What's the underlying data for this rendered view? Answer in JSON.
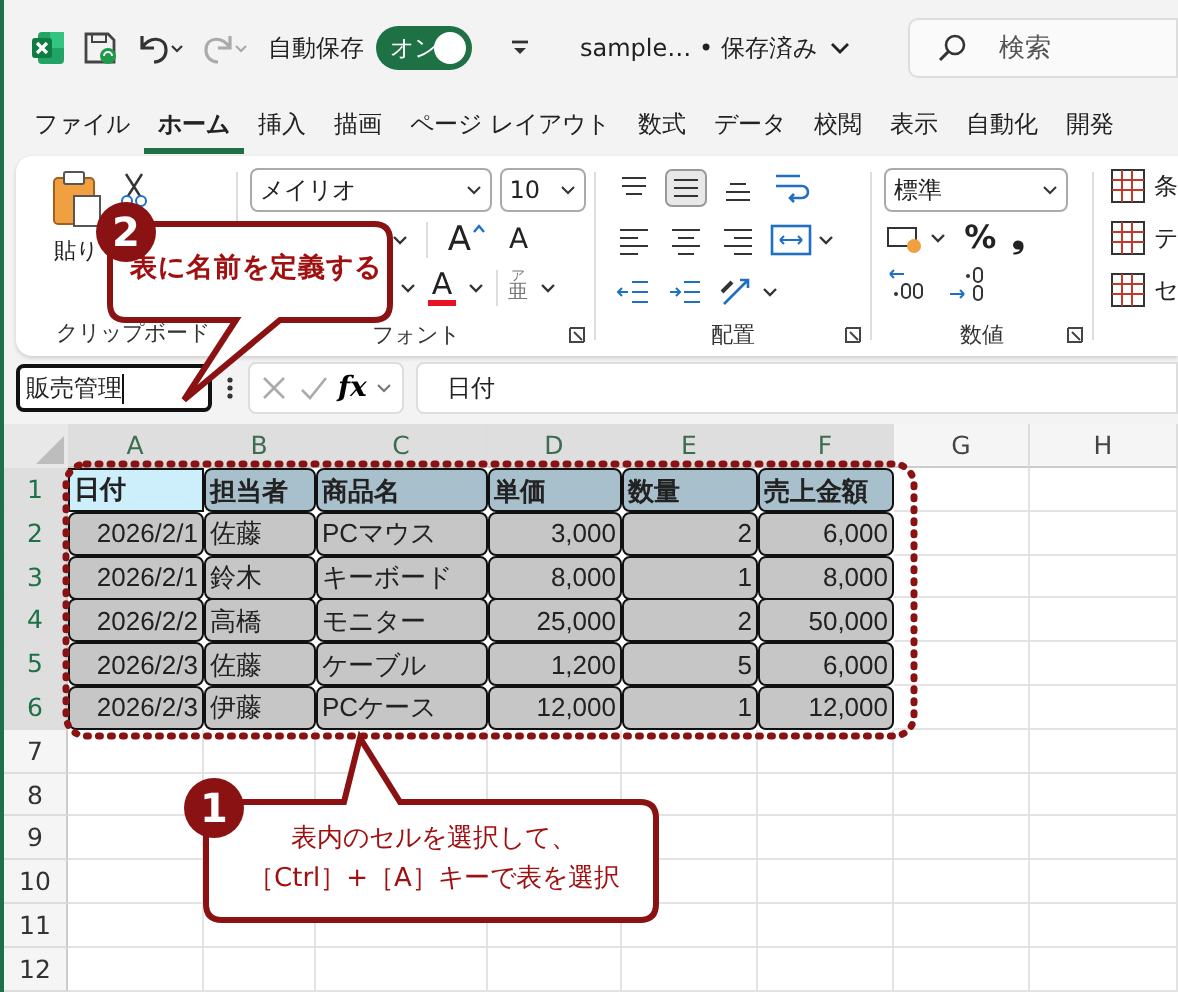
{
  "title_bar": {
    "autosave_label": "自動保存",
    "autosave_toggle": {
      "label": "オン",
      "on": true
    },
    "document_title": "sample… • 保存済み",
    "search": {
      "placeholder": "検索"
    }
  },
  "menu_tabs": [
    {
      "label": "ファイル",
      "selected": false
    },
    {
      "label": "ホーム",
      "selected": true
    },
    {
      "label": "挿入",
      "selected": false
    },
    {
      "label": "描画",
      "selected": false
    },
    {
      "label": "ページ レイアウト",
      "selected": false
    },
    {
      "label": "数式",
      "selected": false
    },
    {
      "label": "データ",
      "selected": false
    },
    {
      "label": "校閲",
      "selected": false
    },
    {
      "label": "表示",
      "selected": false
    },
    {
      "label": "自動化",
      "selected": false
    },
    {
      "label": "開発",
      "selected": false
    }
  ],
  "ribbon": {
    "clipboard": {
      "paste_label": "貼り",
      "group_label": "クリップボード"
    },
    "font": {
      "font_name": "メイリオ",
      "font_size": "10",
      "grow_glyph": "A",
      "shrink_glyph": "A",
      "color_glyph": "A",
      "ruby_glyph": "ア",
      "ruby_base": "亜",
      "group_label": "フォント"
    },
    "alignment": {
      "group_label": "配置"
    },
    "number": {
      "format": "標準",
      "percent": "%",
      "comma": "❟",
      "group_label": "数値"
    },
    "styles": [
      "条",
      "テ",
      "セ"
    ]
  },
  "formula_bar": {
    "name_box": "販売管理",
    "fx": "fx",
    "content": "日付"
  },
  "sheet": {
    "columns": [
      "A",
      "B",
      "C",
      "D",
      "E",
      "F",
      "G",
      "H"
    ],
    "rows": [
      "1",
      "2",
      "3",
      "4",
      "5",
      "6",
      "7",
      "8",
      "9",
      "10",
      "11",
      "12"
    ]
  },
  "table": {
    "selected": true,
    "header": [
      {
        "text": "日付",
        "active": true
      },
      {
        "text": "担当者",
        "active": false
      },
      {
        "text": "商品名",
        "active": false
      },
      {
        "text": "単価",
        "active": false
      },
      {
        "text": "数量",
        "active": false
      },
      {
        "text": "売上金額",
        "active": false
      }
    ],
    "rows": [
      [
        "2026/2/1",
        "佐藤",
        "PCマウス",
        "3,000",
        "2",
        "6,000"
      ],
      [
        "2026/2/1",
        "鈴木",
        "キーボード",
        "8,000",
        "1",
        "8,000"
      ],
      [
        "2026/2/2",
        "高橋",
        "モニター",
        "25,000",
        "2",
        "50,000"
      ],
      [
        "2026/2/3",
        "佐藤",
        "ケーブル",
        "1,200",
        "5",
        "6,000"
      ],
      [
        "2026/2/3",
        "伊藤",
        "PCケース",
        "12,000",
        "1",
        "12,000"
      ]
    ]
  },
  "callouts": [
    {
      "number": "2",
      "text": "表に名前を定義する"
    },
    {
      "number": "1",
      "lines": [
        "表内のセルを選択して、",
        "［Ctrl］+［A］キーで表を選択"
      ]
    }
  ]
}
